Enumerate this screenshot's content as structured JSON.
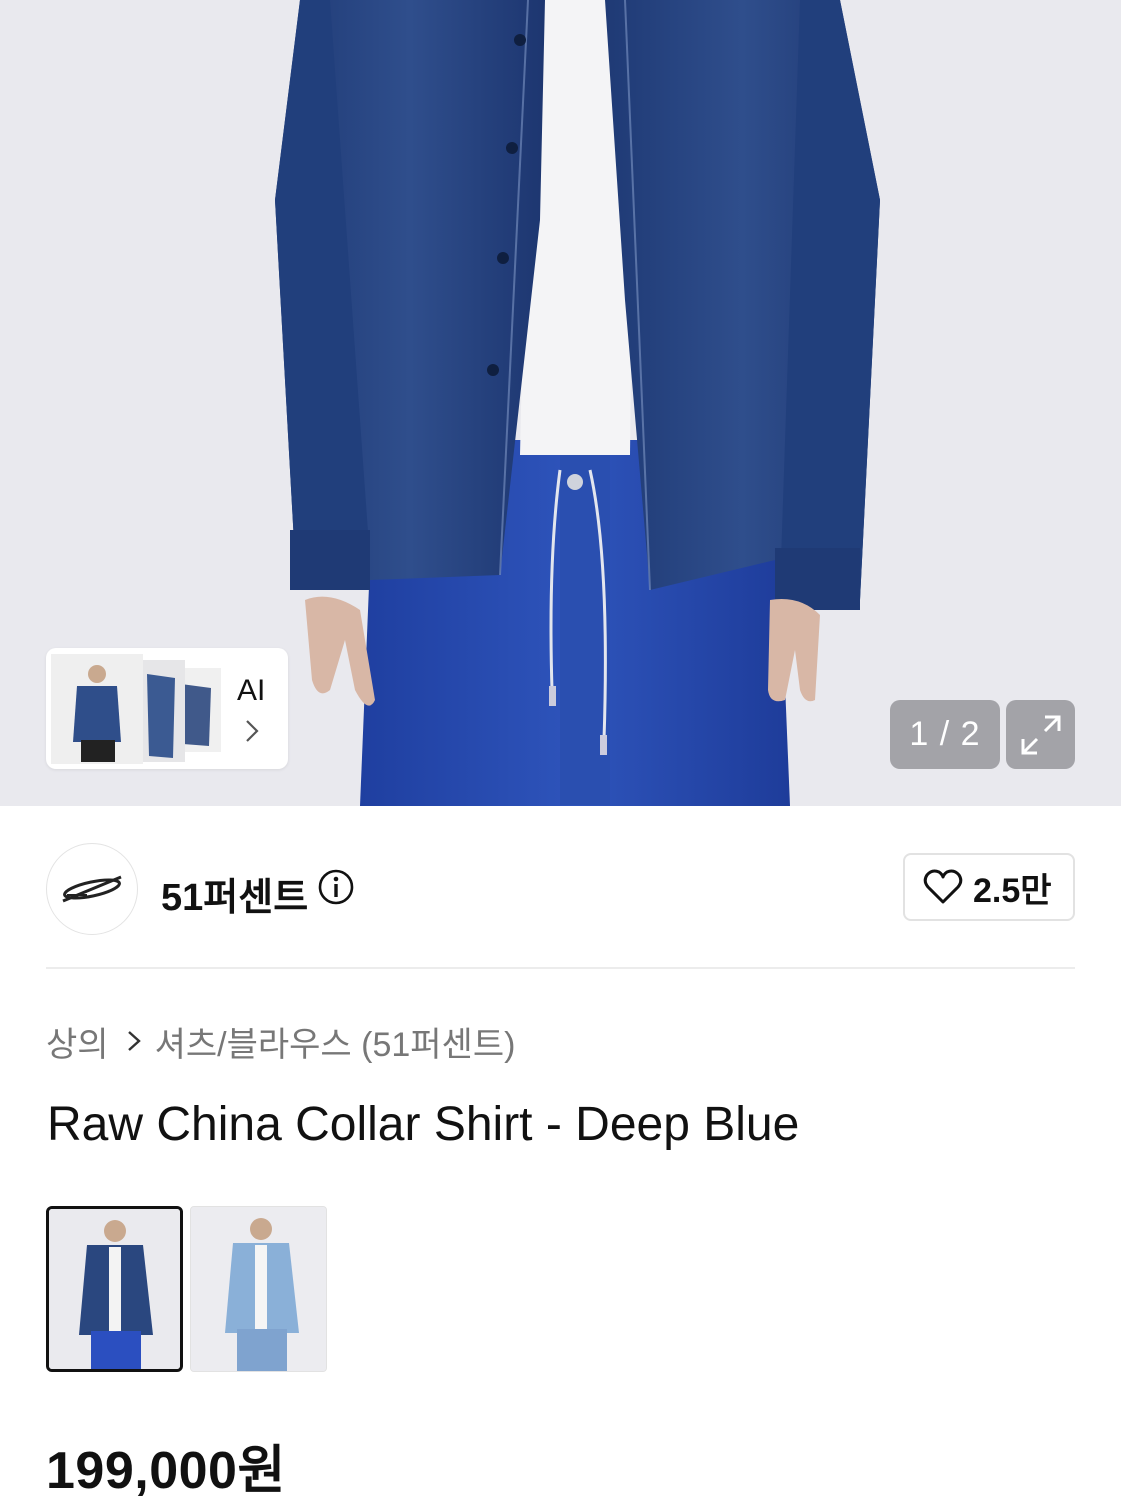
{
  "gallery": {
    "ai_label": "AI",
    "counter": "1 / 2"
  },
  "brand": {
    "name": "51퍼센트",
    "like_count": "2.5만"
  },
  "breadcrumb": {
    "parent": "상의",
    "child": "셔츠/블라우스 (51퍼센트)"
  },
  "product": {
    "title": "Raw China Collar Shirt - Deep Blue",
    "price": "199,000원"
  },
  "colors": {
    "shirt_denim": "#2c4a86",
    "jeans_blue": "#2648a8",
    "backdrop": "#e9e9ee",
    "text_primary": "#111111",
    "text_secondary": "#777777"
  },
  "icons": [
    "chevron-right-icon",
    "expand-icon",
    "info-icon",
    "heart-icon",
    "brand-logo-icon"
  ]
}
